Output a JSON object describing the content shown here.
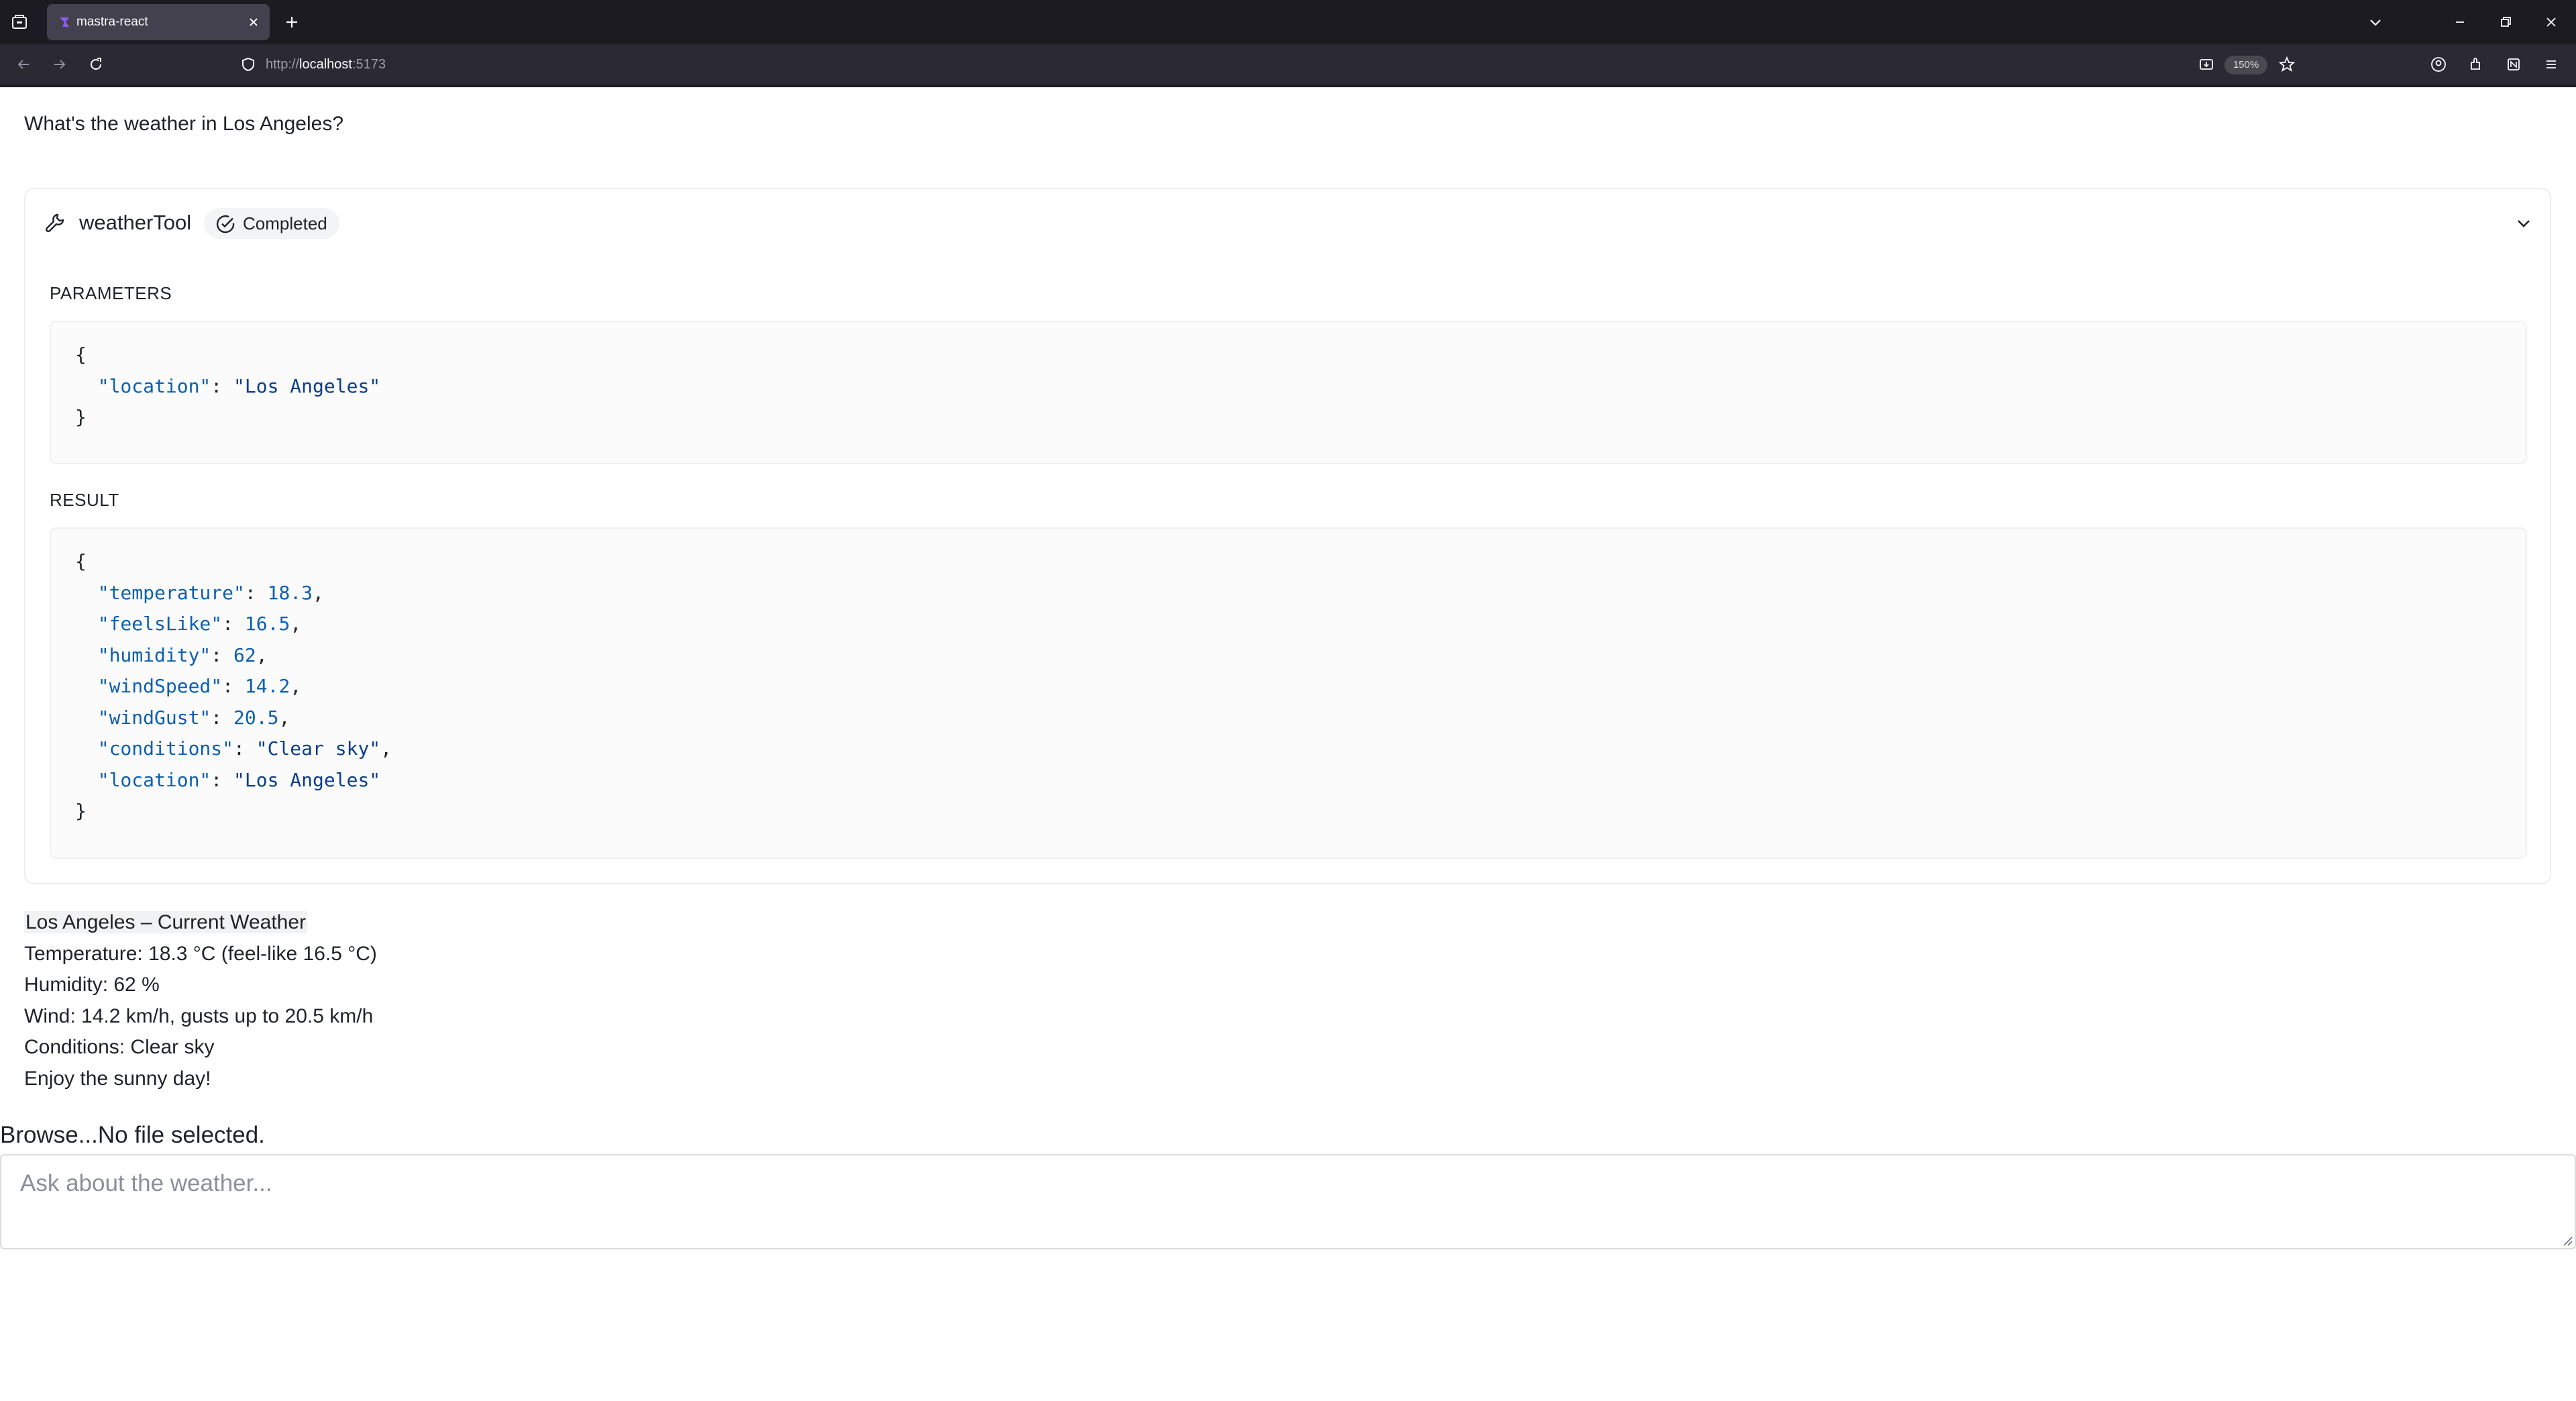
{
  "browser": {
    "tab_title": "mastra-react",
    "url_prefix": "http://",
    "url_host": "localhost",
    "url_port": ":5173",
    "zoom": "150%"
  },
  "conversation": {
    "user_message": "What's the weather in Los Angeles?",
    "tool_call": {
      "name": "weatherTool",
      "status": "Completed",
      "parameters_label": "PARAMETERS",
      "parameters_lines": [
        {
          "p": "{",
          "k": "",
          "sep": "",
          "v": "",
          "vtype": "",
          "end": ""
        },
        {
          "p": "  ",
          "k": "\"location\"",
          "sep": ": ",
          "v": "\"Los Angeles\"",
          "vtype": "s",
          "end": ""
        },
        {
          "p": "}",
          "k": "",
          "sep": "",
          "v": "",
          "vtype": "",
          "end": ""
        }
      ],
      "result_label": "RESULT",
      "result_lines": [
        {
          "p": "{",
          "k": "",
          "sep": "",
          "v": "",
          "vtype": "",
          "end": ""
        },
        {
          "p": "  ",
          "k": "\"temperature\"",
          "sep": ": ",
          "v": "18.3",
          "vtype": "n",
          "end": ","
        },
        {
          "p": "  ",
          "k": "\"feelsLike\"",
          "sep": ": ",
          "v": "16.5",
          "vtype": "n",
          "end": ","
        },
        {
          "p": "  ",
          "k": "\"humidity\"",
          "sep": ": ",
          "v": "62",
          "vtype": "n",
          "end": ","
        },
        {
          "p": "  ",
          "k": "\"windSpeed\"",
          "sep": ": ",
          "v": "14.2",
          "vtype": "n",
          "end": ","
        },
        {
          "p": "  ",
          "k": "\"windGust\"",
          "sep": ": ",
          "v": "20.5",
          "vtype": "n",
          "end": ","
        },
        {
          "p": "  ",
          "k": "\"conditions\"",
          "sep": ": ",
          "v": "\"Clear sky\"",
          "vtype": "s",
          "end": ","
        },
        {
          "p": "  ",
          "k": "\"location\"",
          "sep": ": ",
          "v": "\"Los Angeles\"",
          "vtype": "s",
          "end": ""
        },
        {
          "p": "}",
          "k": "",
          "sep": "",
          "v": "",
          "vtype": "",
          "end": ""
        }
      ]
    },
    "assistant_reply": {
      "title": "Los Angeles – Current Weather",
      "lines": [
        "Temperature: 18.3 °C (feel‑like 16.5 °C)",
        "Humidity: 62 %",
        "Wind: 14.2 km/h, gusts up to 20.5 km/h",
        "Conditions: Clear sky",
        "Enjoy the sunny day!"
      ]
    }
  },
  "composer": {
    "browse_label": "Browse...",
    "file_status": "No file selected.",
    "placeholder": "Ask about the weather..."
  },
  "colors": {
    "json_key": "#0b5fb0",
    "json_string": "#0b3d8a",
    "chrome_dark": "#1c1b22",
    "chrome_nav": "#2b2a33"
  }
}
